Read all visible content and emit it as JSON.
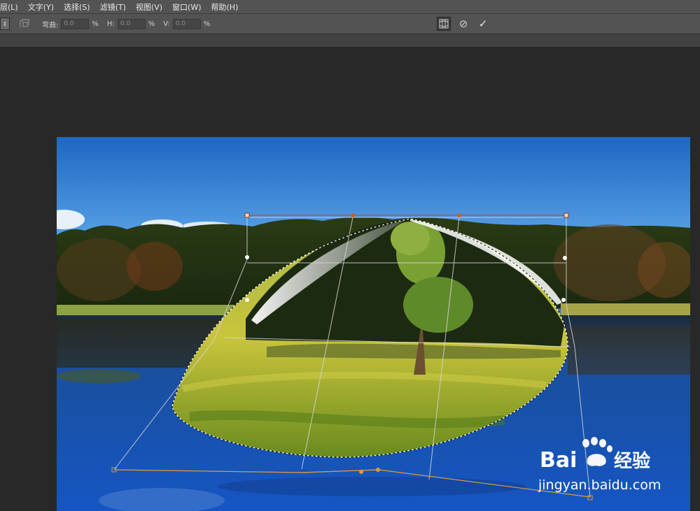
{
  "menubar": {
    "items": [
      {
        "label": "层(L)"
      },
      {
        "label": "文字(Y)"
      },
      {
        "label": "选择(S)"
      },
      {
        "label": "滤镜(T)"
      },
      {
        "label": "视图(V)"
      },
      {
        "label": "窗口(W)"
      },
      {
        "label": "帮助(H)"
      }
    ]
  },
  "options": {
    "mode_arrow": "⇕",
    "warp_label": "弯曲:",
    "warp_value": "0.0",
    "h_label": "H:",
    "h_value": "0.0",
    "v_label": "V:",
    "v_value": "0.0",
    "unit": "%",
    "confirm_glyph": "✓",
    "cancel_glyph": "⊘"
  },
  "watermark": {
    "brand_lead": "Bai",
    "brand_tail": "经验",
    "url": "jingyan.baidu.com"
  },
  "colors": {
    "chrome": "#535353",
    "workspace": "#282828",
    "handle": "#e08a2a",
    "handle_top": "#b04a1c",
    "grid": "#cfcfcf"
  }
}
